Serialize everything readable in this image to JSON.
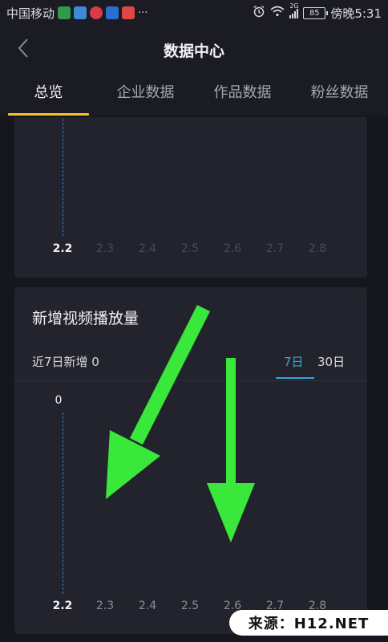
{
  "status_bar": {
    "carrier": "中国移动",
    "network": "2G",
    "battery": "85",
    "time": "傍晚5:31",
    "more": "···"
  },
  "header": {
    "title": "数据中心"
  },
  "tabs": [
    {
      "label": "总览",
      "active": true
    },
    {
      "label": "企业数据",
      "active": false
    },
    {
      "label": "作品数据",
      "active": false
    },
    {
      "label": "粉丝数据",
      "active": false
    }
  ],
  "top_chart": {
    "x_ticks": [
      "2.2",
      "2.3",
      "2.4",
      "2.5",
      "2.6",
      "2.7",
      "2.8"
    ]
  },
  "video_card": {
    "title": "新增视频播放量",
    "subtitle": "近7日新增 0",
    "ranges": [
      "7日",
      "30日"
    ],
    "selected_range": "7日",
    "y_value_label": "0",
    "x_ticks": [
      "2.2",
      "2.3",
      "2.4",
      "2.5",
      "2.6",
      "2.7",
      "2.8"
    ]
  },
  "chart_data": {
    "type": "line",
    "x": [
      "2.2",
      "2.3",
      "2.4",
      "2.5",
      "2.6",
      "2.7",
      "2.8"
    ],
    "series": [
      {
        "values": [
          0,
          null,
          null,
          null,
          null,
          null,
          null
        ]
      }
    ],
    "title": "新增视频播放量"
  },
  "watermark": {
    "text": "来源：H12.NET"
  },
  "colors": {
    "accent_tab": "#f6c42a",
    "accent_range": "#35a7d8",
    "arrow": "#39e83a"
  },
  "icons": [
    "back-icon",
    "alarm-icon",
    "wifi-icon",
    "signal-icon",
    "battery-icon"
  ]
}
